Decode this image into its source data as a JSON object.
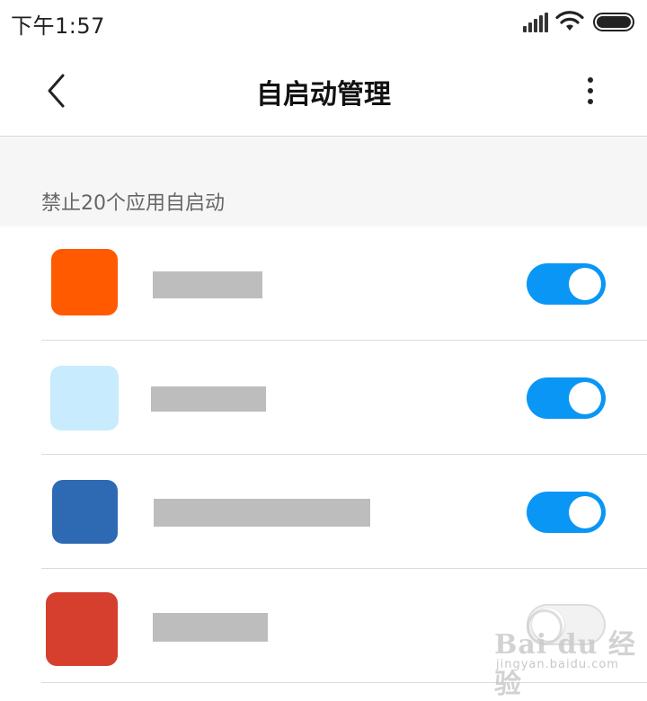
{
  "status_bar": {
    "time": "下午1:57",
    "icons": [
      "signal-icon",
      "wifi-icon",
      "battery-icon"
    ]
  },
  "header": {
    "title": "自启动管理",
    "back_icon": "chevron-left-icon",
    "menu_icon": "more-vertical-icon"
  },
  "section": {
    "title": "禁止20个应用自启动"
  },
  "apps": [
    {
      "icon_color": "#ff5a00",
      "name_redacted": true,
      "autostart_enabled": true
    },
    {
      "icon_color": "#c8ecfd",
      "name_redacted": true,
      "autostart_enabled": true
    },
    {
      "icon_color": "#2e6ab3",
      "name_redacted": true,
      "autostart_enabled": true
    },
    {
      "icon_color": "#d63e2e",
      "name_redacted": true,
      "autostart_enabled": false
    }
  ],
  "colors": {
    "toggle_on": "#0a96f5",
    "toggle_off": "#f2f2f2",
    "section_bg": "#f6f6f6",
    "redaction": "#bdbdbd"
  },
  "watermark": {
    "logo": "Bai du 经验",
    "subtext": "jingyan.baidu.com"
  }
}
